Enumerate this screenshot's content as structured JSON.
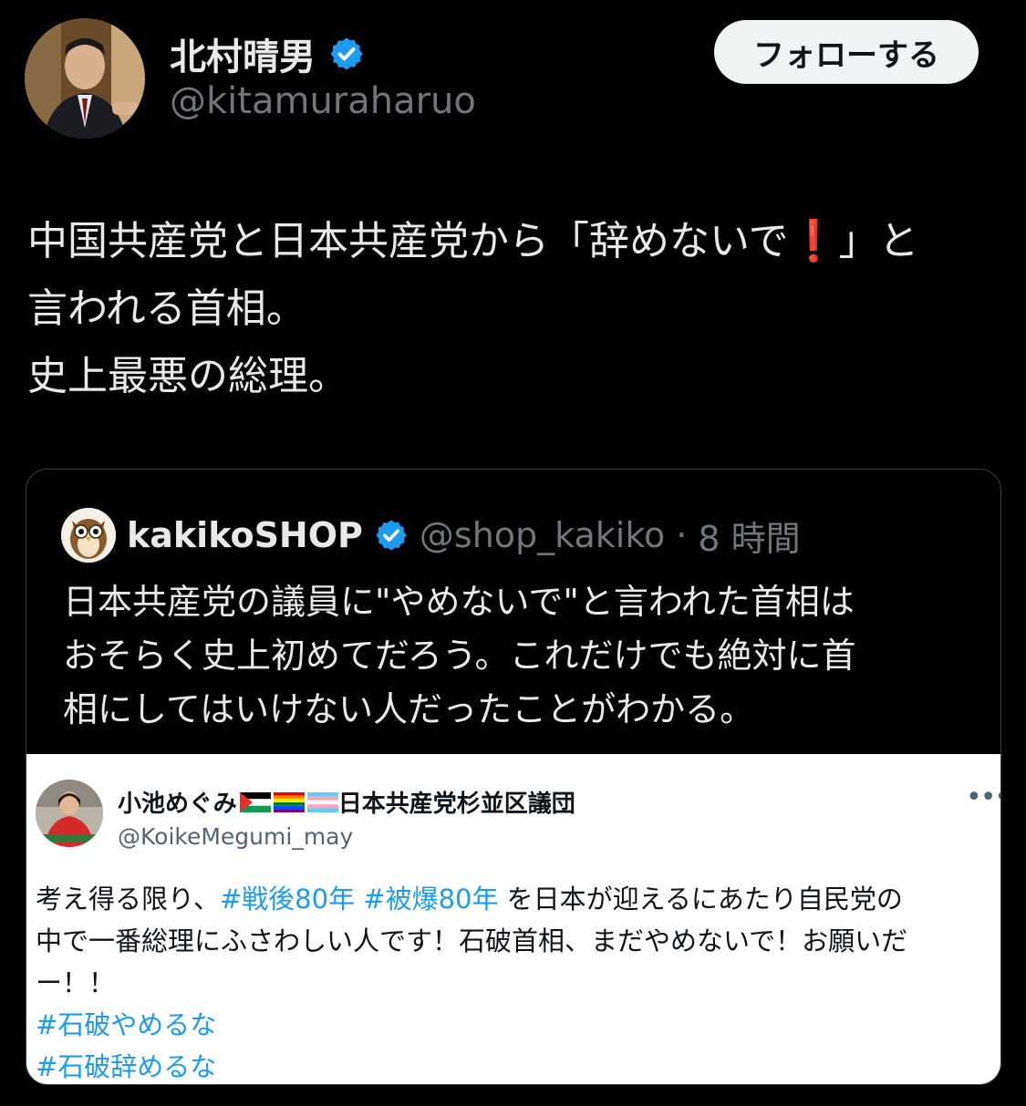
{
  "author": {
    "name": "北村晴男",
    "handle": "@kitamuraharuo",
    "verified": true
  },
  "follow_button": "フォローする",
  "tweet": {
    "line1_a": "中国共産党と日本共産党から「辞めないで",
    "line1_b": "」と",
    "line2": "言われる首相。",
    "line3": "史上最悪の総理。"
  },
  "quote": {
    "name": "kakikoSHOP",
    "handle": "@shop_kakiko",
    "separator": "·",
    "time": "8 時間",
    "lines": [
      "日本共産党の議員に\"やめないで\"と言われた首相は",
      "おそらく史上初めてだろう。これだけでも絶対に首",
      "相にしてはいけない人だったことがわかる。"
    ]
  },
  "embedded": {
    "name": "小池めぐみ",
    "name_suffix": "日本共産党杉並区議団",
    "handle": "@KoikeMegumi_may",
    "more": "•••",
    "text_a": "考え得る限り、",
    "tag1": "#戦後80年",
    "tag2": "#被爆80年",
    "text_b": " を日本が迎えるにあたり自民党の",
    "line2": "中で一番総理にふさわしい人です！石破首相、まだやめないで！お願いだ",
    "line3": "ー！！",
    "tag3": "#石破やめるな",
    "tag4": "#石破辞めるな"
  },
  "colors": {
    "verified_badge": "#1d9bf0",
    "hashtag": "#1d9bf0",
    "exclamation": "#e0202a",
    "background": "#000000",
    "muted": "#71767b"
  }
}
